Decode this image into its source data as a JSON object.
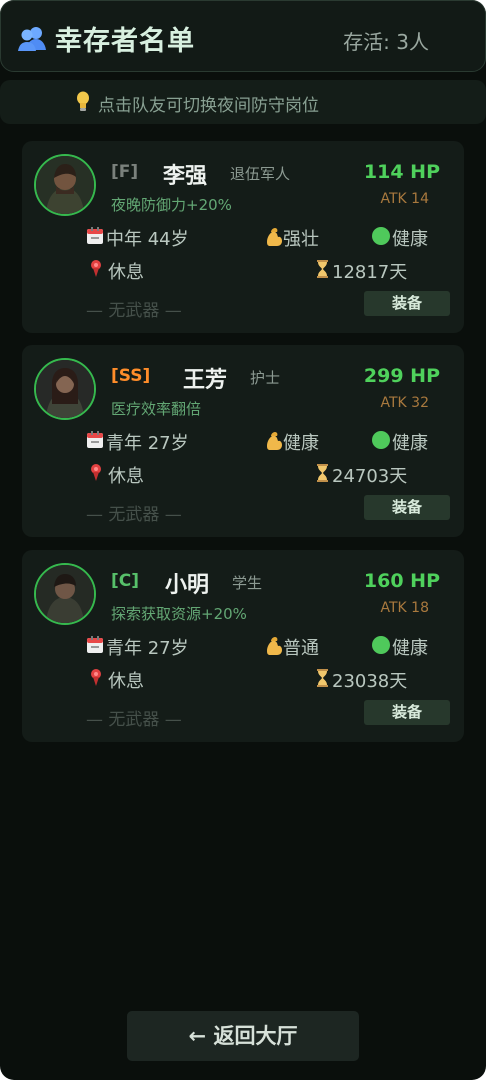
{
  "header": {
    "icon": "group-users-icon",
    "title": "幸存者名单",
    "survivor_count_text": "存活: 3人"
  },
  "hint": {
    "icon": "lightbulb-icon",
    "text": "点击队友可切换夜间防守岗位"
  },
  "survivors": [
    {
      "rank": "[F]",
      "rank_color": "#7a817c",
      "name": "李强",
      "role": "退伍军人",
      "perk": "夜晚防御力+20%",
      "hp": "114 HP",
      "atk": "ATK 14",
      "age": "中年 44岁",
      "strength": "强壮",
      "health": "健康",
      "status": "休息",
      "days": "12817天",
      "weapon": "— 无武器 —",
      "equip_label": "装备"
    },
    {
      "rank": "[SS]",
      "rank_color": "#ff8d2a",
      "name": "王芳",
      "role": "护士",
      "perk": "医疗效率翻倍",
      "hp": "299 HP",
      "atk": "ATK 32",
      "age": "青年 27岁",
      "strength": "健康",
      "health": "健康",
      "status": "休息",
      "days": "24703天",
      "weapon": "— 无武器 —",
      "equip_label": "装备"
    },
    {
      "rank": "[C]",
      "rank_color": "#57c06a",
      "name": "小明",
      "role": "学生",
      "perk": "探索获取资源+20%",
      "hp": "160 HP",
      "atk": "ATK 18",
      "age": "青年 27岁",
      "strength": "普通",
      "health": "健康",
      "status": "休息",
      "days": "23038天",
      "weapon": "— 无武器 —",
      "equip_label": "装备"
    }
  ],
  "icons": {
    "avatar": "survivor-portrait",
    "age": "calendar-icon",
    "strength": "flexed-biceps-icon",
    "health": "green-circle-icon",
    "location": "location-pin-icon",
    "days": "hourglass-icon"
  },
  "footer": {
    "back_label": "← 返回大厅"
  },
  "colors": {
    "background": "#0a0f0c",
    "panel": "#141c18",
    "hp": "#4fd15c",
    "atk": "#a9793e",
    "accent": "#36b94e"
  }
}
